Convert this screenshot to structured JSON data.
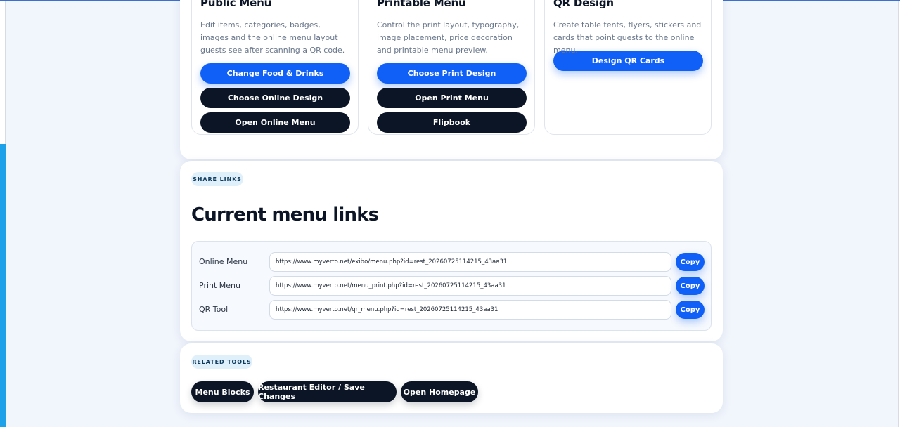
{
  "cards": [
    {
      "title": "Public Menu",
      "description": "Edit items, categories, badges, images and the online menu layout guests see after scanning a QR code.",
      "buttons": [
        "Change Food & Drinks",
        "Choose Online Design",
        "Open Online Menu"
      ]
    },
    {
      "title": "Printable Menu",
      "description": "Control the print layout, typography, image placement, price decoration and printable menu preview.",
      "buttons": [
        "Choose Print Design",
        "Open Print Menu",
        "Flipbook"
      ]
    },
    {
      "title": "QR Design",
      "description": "Create table tents, flyers, stickers and cards that point guests to the online menu.",
      "buttons": [
        "Design QR Cards"
      ]
    }
  ],
  "share": {
    "badge": "SHARE LINKS",
    "heading": "Current menu links",
    "copy_label": "Copy",
    "links": [
      {
        "label": "Online Menu",
        "url": "https://www.myverto.net/exibo/menu.php?id=rest_20260725114215_43aa31"
      },
      {
        "label": "Print Menu",
        "url": "https://www.myverto.net/menu_print.php?id=rest_20260725114215_43aa31"
      },
      {
        "label": "QR Tool",
        "url": "https://www.myverto.net/qr_menu.php?id=rest_20260725114215_43aa31"
      }
    ]
  },
  "tools": {
    "badge": "RELATED TOOLS",
    "buttons": [
      "Menu Blocks",
      "Restaurant Editor / Save Changes",
      "Open Homepage"
    ]
  },
  "colors": {
    "accent_blue": "#1060f7",
    "dark": "#0b1526",
    "page_bg": "#f1f5fc"
  }
}
